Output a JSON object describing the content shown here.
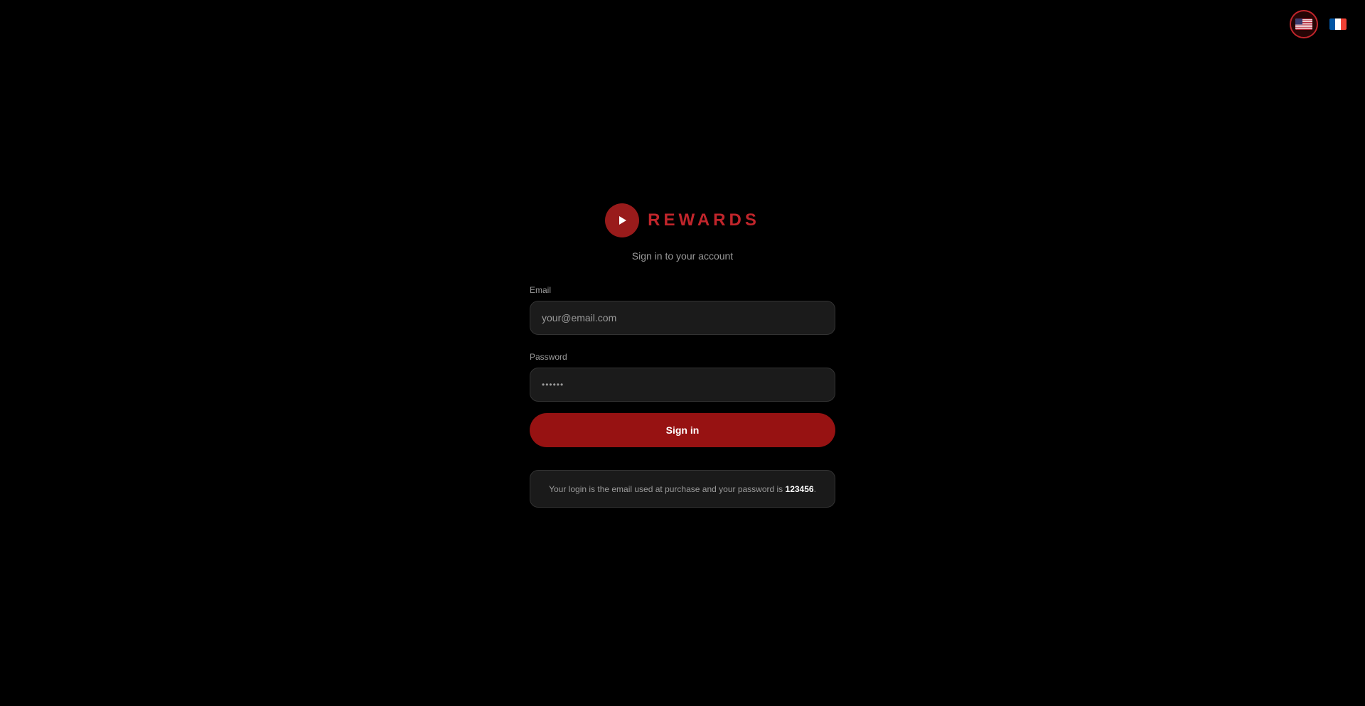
{
  "language_switcher": {
    "options": [
      {
        "code": "en",
        "icon": "us-flag-icon",
        "active": true
      },
      {
        "code": "fr",
        "icon": "fr-flag-icon",
        "active": false
      }
    ]
  },
  "brand": {
    "logo_icon": "play-icon",
    "name": "REWARDS",
    "accent_color": "#c0252b"
  },
  "subtitle": "Sign in to your account",
  "form": {
    "email": {
      "label": "Email",
      "placeholder": "your@email.com"
    },
    "password": {
      "label": "Password",
      "value_masked": "••••••"
    },
    "submit_label": "Sign in"
  },
  "info": {
    "text_before": "Your login is the email used at purchase and your password is ",
    "password_hint": "123456",
    "text_after": "."
  },
  "colors": {
    "background": "#000000",
    "button": "#971212",
    "input_background": "#1b1b1b"
  }
}
